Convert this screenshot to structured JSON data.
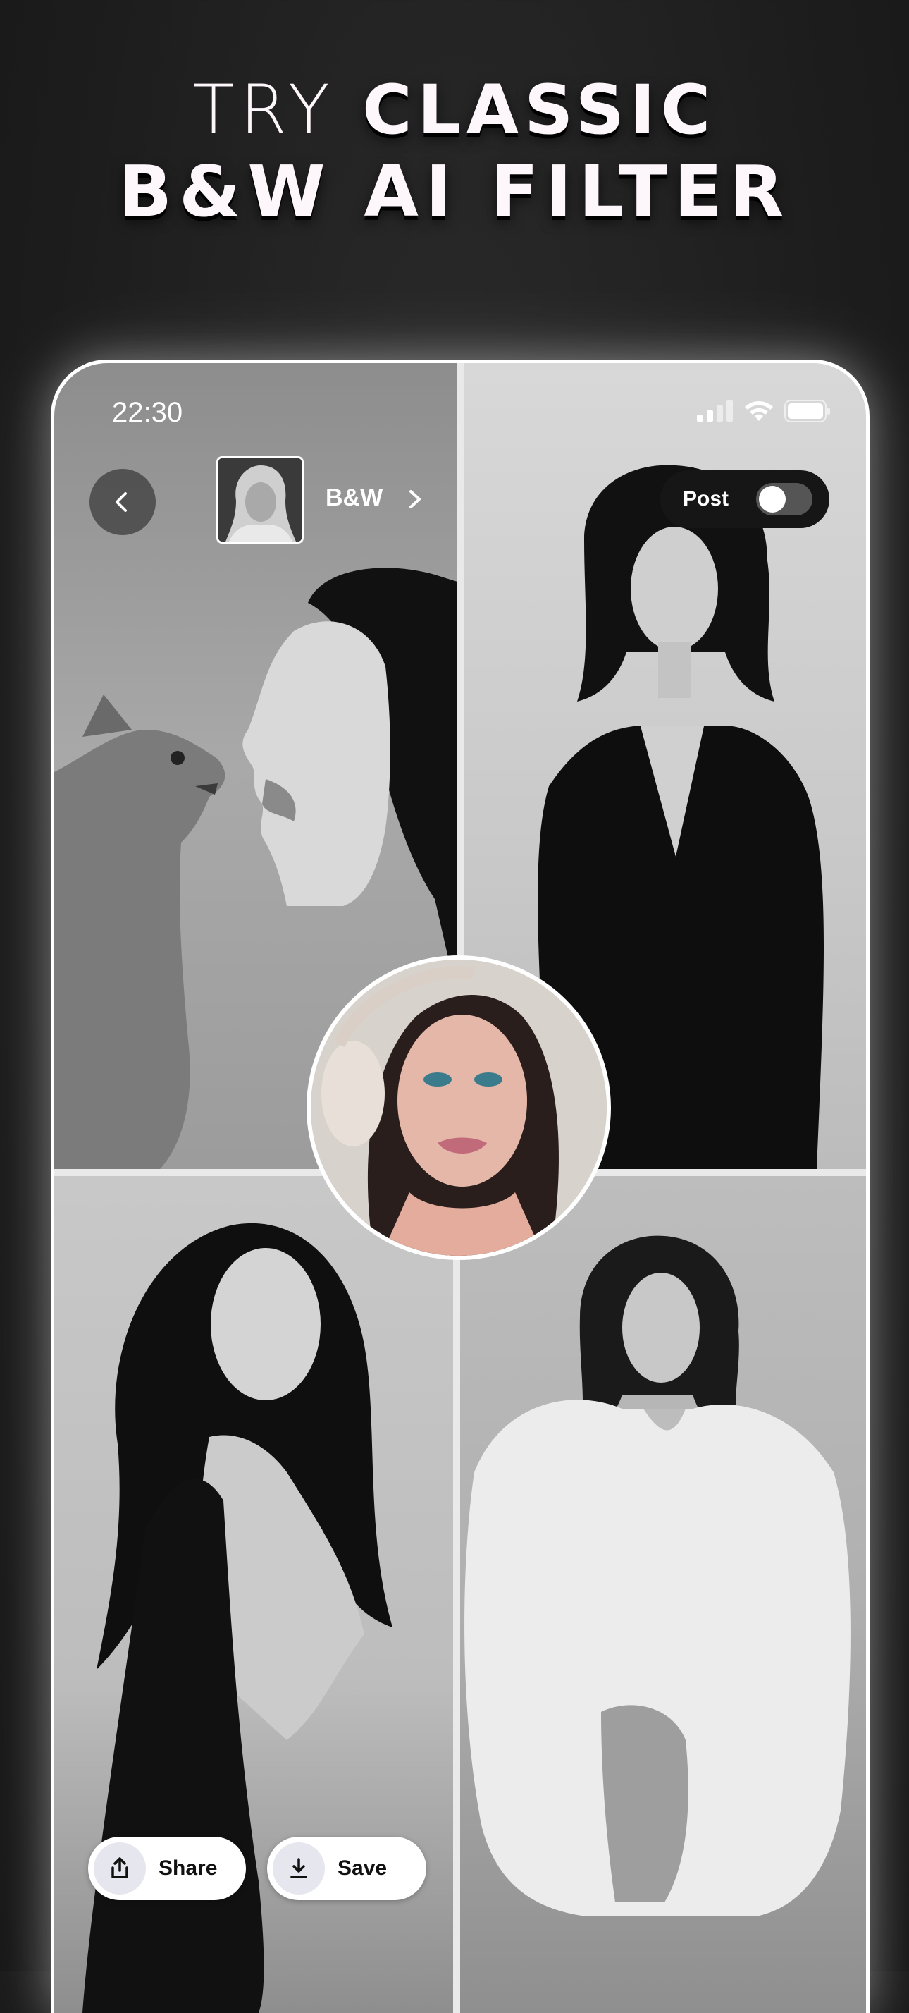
{
  "headline": {
    "line1_light": "TRY ",
    "line1_bold": "CLASSIC",
    "line2": "B&W AI FILTER"
  },
  "status_bar": {
    "time": "22:30",
    "icons": [
      "signal-icon",
      "wifi-icon",
      "battery-icon"
    ]
  },
  "toolbar": {
    "back_icon": "chevron-left-icon",
    "filter_name": "B&W",
    "filter_chevron": "chevron-right-icon"
  },
  "post_toggle": {
    "label": "Post",
    "enabled": false
  },
  "actions": {
    "share_label": "Share",
    "share_icon": "share-icon",
    "save_label": "Save",
    "save_icon": "download-icon"
  },
  "colors": {
    "background": "#1d1d1d",
    "headline_text": "#fdf6fb",
    "pill_bg": "#161616"
  }
}
